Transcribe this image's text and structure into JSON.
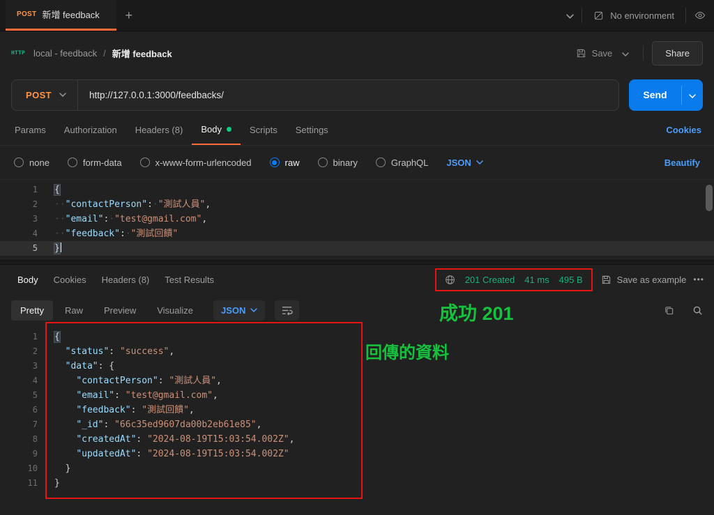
{
  "colors": {
    "accent_orange": "#ff6c37",
    "method_post": "#ff9544",
    "send_blue": "#097bed",
    "link_blue": "#4c9df8",
    "status_green": "#1ab178",
    "annotation_green": "#17c13e",
    "annotation_red": "#e81313",
    "code_key": "#9cdcfe",
    "code_string": "#ce9178",
    "body_dot_green": "#0acf83"
  },
  "topbar": {
    "tab_method": "POST",
    "tab_title": "新增 feedback",
    "new_tab": "+",
    "environment": "No environment"
  },
  "header": {
    "collection": "local - feedback",
    "separator": "/",
    "request_name": "新增 feedback",
    "save": "Save",
    "share": "Share"
  },
  "url_bar": {
    "method": "POST",
    "url": "http://127.0.0.1:3000/feedbacks/",
    "send": "Send"
  },
  "request_tabs": {
    "params": "Params",
    "authorization": "Authorization",
    "headers": "Headers (8)",
    "body": "Body",
    "scripts": "Scripts",
    "settings": "Settings",
    "cookies": "Cookies"
  },
  "body_options": {
    "none": "none",
    "form_data": "form-data",
    "urlencoded": "x-www-form-urlencoded",
    "raw": "raw",
    "binary": "binary",
    "graphql": "GraphQL",
    "format": "JSON",
    "beautify": "Beautify"
  },
  "request_editor": {
    "cursor_line": 5,
    "lines": [
      {
        "n": 1,
        "t": [
          [
            "hb",
            "{"
          ]
        ]
      },
      {
        "n": 2,
        "t": [
          [
            "w",
            "··"
          ],
          [
            "k",
            "\"contactPerson\""
          ],
          [
            "p",
            ":"
          ],
          [
            "w",
            "·"
          ],
          [
            "s",
            "\"測試人員\""
          ],
          [
            "p",
            ","
          ]
        ]
      },
      {
        "n": 3,
        "t": [
          [
            "w",
            "··"
          ],
          [
            "k",
            "\"email\""
          ],
          [
            "p",
            ":"
          ],
          [
            "w",
            "·"
          ],
          [
            "s",
            "\"test@gmail.com\""
          ],
          [
            "p",
            ","
          ]
        ]
      },
      {
        "n": 4,
        "t": [
          [
            "w",
            "··"
          ],
          [
            "k",
            "\"feedback\""
          ],
          [
            "p",
            ":"
          ],
          [
            "w",
            "·"
          ],
          [
            "s",
            "\"測試回饋\""
          ]
        ]
      },
      {
        "n": 5,
        "t": [
          [
            "hb",
            "}"
          ]
        ]
      }
    ]
  },
  "response": {
    "tab_body": "Body",
    "tab_cookies": "Cookies",
    "tab_headers": "Headers (8)",
    "tab_tests": "Test Results",
    "status": "201 Created",
    "time": "41 ms",
    "size": "495 B",
    "save_as_example": "Save as example",
    "more": "•••",
    "view_pretty": "Pretty",
    "view_raw": "Raw",
    "view_preview": "Preview",
    "view_visualize": "Visualize",
    "format": "JSON"
  },
  "response_editor": {
    "lines": [
      {
        "n": 1,
        "t": [
          [
            "hb",
            "{"
          ]
        ]
      },
      {
        "n": 2,
        "t": [
          [
            "w",
            "  "
          ],
          [
            "k",
            "\"status\""
          ],
          [
            "p",
            ": "
          ],
          [
            "s",
            "\"success\""
          ],
          [
            "p",
            ","
          ]
        ]
      },
      {
        "n": 3,
        "t": [
          [
            "w",
            "  "
          ],
          [
            "k",
            "\"data\""
          ],
          [
            "p",
            ": {"
          ]
        ]
      },
      {
        "n": 4,
        "t": [
          [
            "w",
            "    "
          ],
          [
            "k",
            "\"contactPerson\""
          ],
          [
            "p",
            ": "
          ],
          [
            "s",
            "\"測試人員\""
          ],
          [
            "p",
            ","
          ]
        ]
      },
      {
        "n": 5,
        "t": [
          [
            "w",
            "    "
          ],
          [
            "k",
            "\"email\""
          ],
          [
            "p",
            ": "
          ],
          [
            "s",
            "\"test@gmail.com\""
          ],
          [
            "p",
            ","
          ]
        ]
      },
      {
        "n": 6,
        "t": [
          [
            "w",
            "    "
          ],
          [
            "k",
            "\"feedback\""
          ],
          [
            "p",
            ": "
          ],
          [
            "s",
            "\"測試回饋\""
          ],
          [
            "p",
            ","
          ]
        ]
      },
      {
        "n": 7,
        "t": [
          [
            "w",
            "    "
          ],
          [
            "k",
            "\"_id\""
          ],
          [
            "p",
            ": "
          ],
          [
            "s",
            "\"66c35ed9607da00b2eb61e85\""
          ],
          [
            "p",
            ","
          ]
        ]
      },
      {
        "n": 8,
        "t": [
          [
            "w",
            "    "
          ],
          [
            "k",
            "\"createdAt\""
          ],
          [
            "p",
            ": "
          ],
          [
            "s",
            "\"2024-08-19T15:03:54.002Z\""
          ],
          [
            "p",
            ","
          ]
        ]
      },
      {
        "n": 9,
        "t": [
          [
            "w",
            "    "
          ],
          [
            "k",
            "\"updatedAt\""
          ],
          [
            "p",
            ": "
          ],
          [
            "s",
            "\"2024-08-19T15:03:54.002Z\""
          ]
        ]
      },
      {
        "n": 10,
        "t": [
          [
            "w",
            "  "
          ],
          [
            "p",
            "}"
          ]
        ]
      },
      {
        "n": 11,
        "t": [
          [
            "p",
            "}"
          ]
        ]
      }
    ]
  },
  "annotations": {
    "success": "成功 201",
    "returned_data": "回傳的資料"
  }
}
